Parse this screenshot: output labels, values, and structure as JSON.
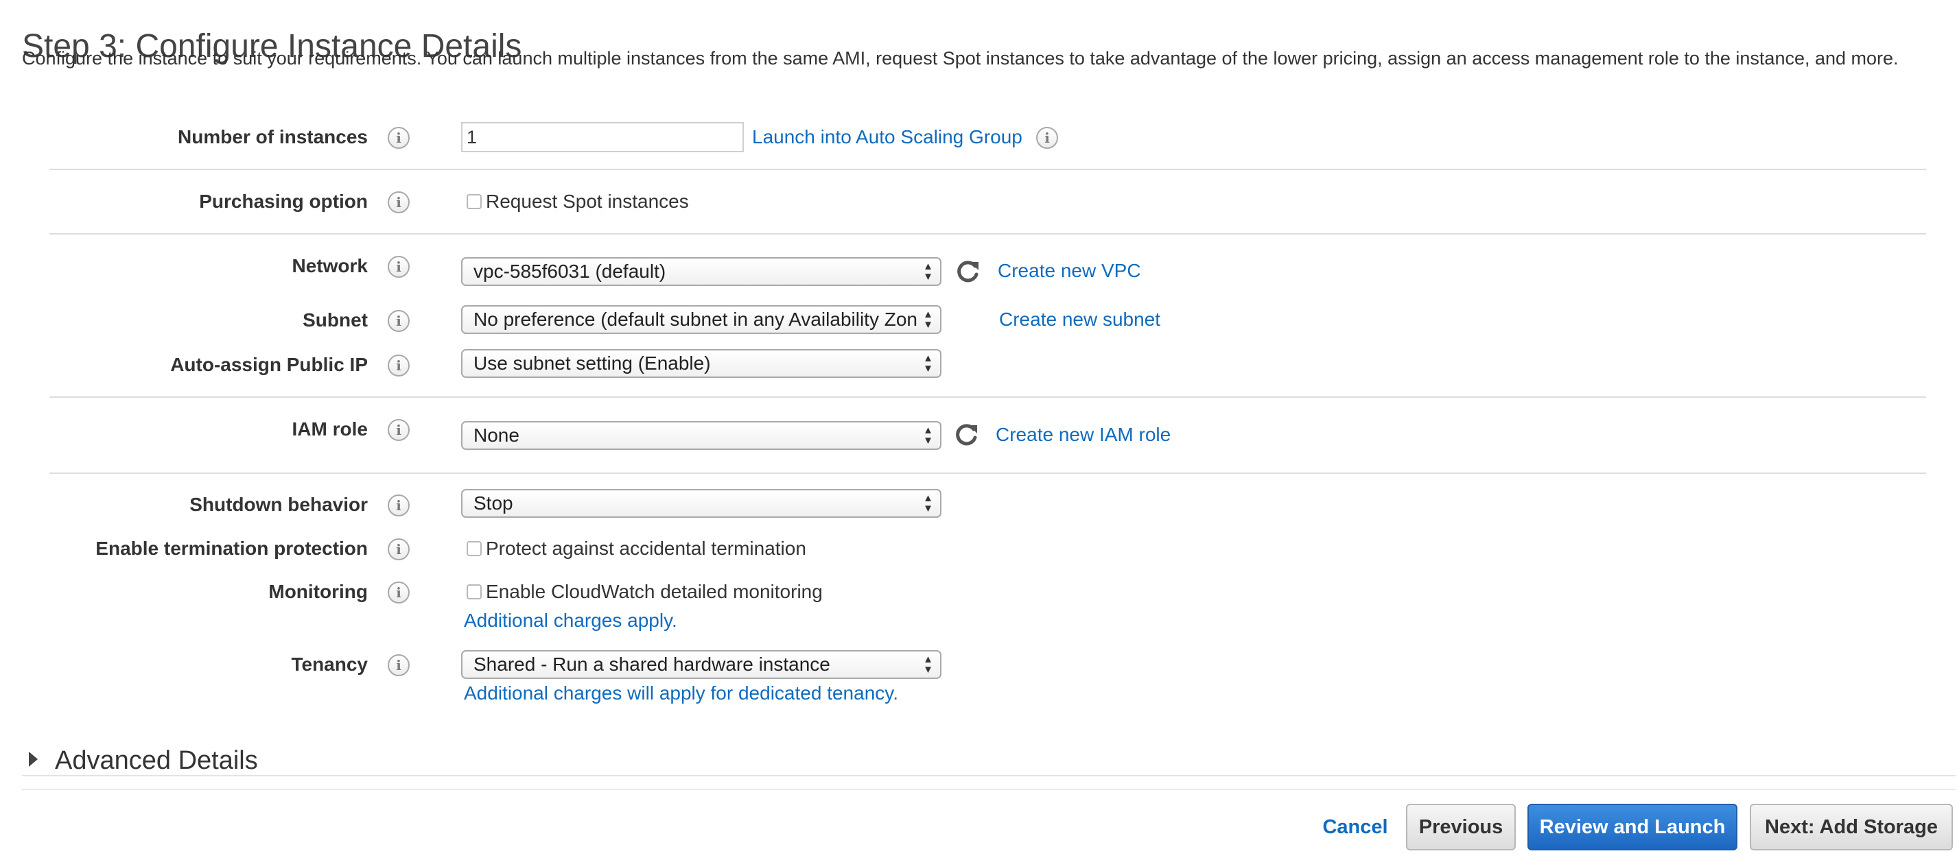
{
  "page": {
    "title": "Step 3: Configure Instance Details",
    "description": "Configure the instance to suit your requirements. You can launch multiple instances from the same AMI, request Spot instances to take advantage of the lower pricing, assign an access management role to the instance, and more."
  },
  "form": {
    "number_of_instances": {
      "label": "Number of instances",
      "value": "1",
      "link": "Launch into Auto Scaling Group"
    },
    "purchasing_option": {
      "label": "Purchasing option",
      "checkbox_label": "Request Spot instances",
      "checked": false
    },
    "network": {
      "label": "Network",
      "value": "vpc-585f6031 (default)",
      "link": "Create new VPC"
    },
    "subnet": {
      "label": "Subnet",
      "value": "No preference (default subnet in any Availability Zone)",
      "link": "Create new subnet"
    },
    "auto_assign_public_ip": {
      "label": "Auto-assign Public IP",
      "value": "Use subnet setting (Enable)"
    },
    "iam_role": {
      "label": "IAM role",
      "value": "None",
      "link": "Create new IAM role"
    },
    "shutdown_behavior": {
      "label": "Shutdown behavior",
      "value": "Stop"
    },
    "termination_protection": {
      "label": "Enable termination protection",
      "checkbox_label": "Protect against accidental termination",
      "checked": false
    },
    "monitoring": {
      "label": "Monitoring",
      "checkbox_label": "Enable CloudWatch detailed monitoring",
      "checked": false,
      "note": "Additional charges apply."
    },
    "tenancy": {
      "label": "Tenancy",
      "value": "Shared - Run a shared hardware instance",
      "note": "Additional charges will apply for dedicated tenancy."
    }
  },
  "advanced": {
    "label": "Advanced Details",
    "expanded": false
  },
  "footer": {
    "cancel": "Cancel",
    "previous": "Previous",
    "review_and_launch": "Review and Launch",
    "next": "Next: Add Storage"
  },
  "icons": {
    "info": "i",
    "select_arrows": "▲▼"
  },
  "colors": {
    "link": "#0f6bbf",
    "primary_button": "#1d67c0",
    "divider": "#dddddd"
  }
}
